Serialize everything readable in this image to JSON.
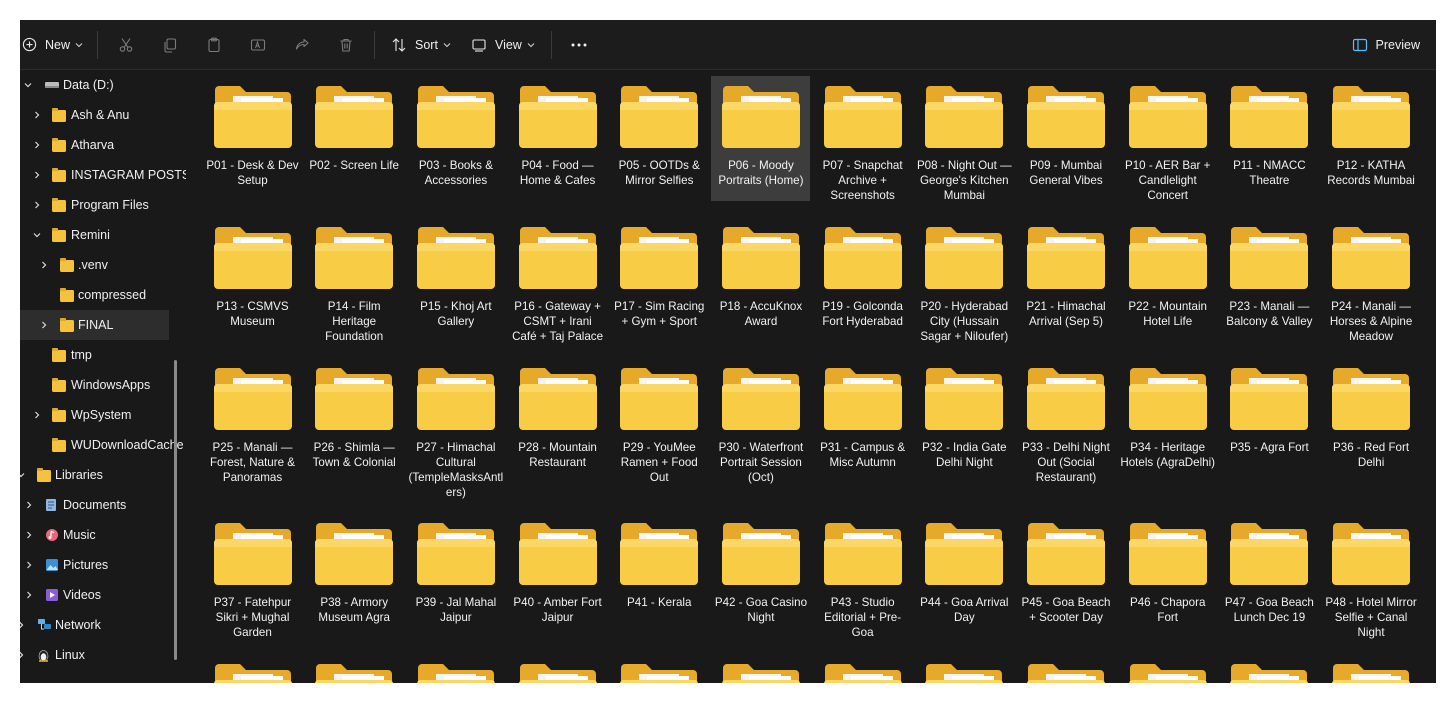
{
  "toolbar": {
    "new_label": "New",
    "sort_label": "Sort",
    "view_label": "View",
    "more_label": "•••",
    "preview_label": "Preview"
  },
  "sidebar": {
    "drive": "Data (D:)",
    "items": [
      {
        "label": "Ash &  Anu"
      },
      {
        "label": "Atharva"
      },
      {
        "label": "INSTAGRAM POSTS"
      },
      {
        "label": "Program Files"
      },
      {
        "label": "Remini"
      },
      {
        "label": ".venv"
      },
      {
        "label": "compressed"
      },
      {
        "label": "FINAL"
      },
      {
        "label": "tmp"
      },
      {
        "label": "WindowsApps"
      },
      {
        "label": "WpSystem"
      },
      {
        "label": "WUDownloadCache"
      }
    ],
    "libraries": "Libraries",
    "documents": "Documents",
    "music": "Music",
    "pictures": "Pictures",
    "videos": "Videos",
    "network": "Network",
    "linux": "Linux"
  },
  "folders": [
    "P01 - Desk & Dev Setup",
    "P02 - Screen Life",
    "P03 - Books & Accessories",
    "P04 - Food — Home & Cafes",
    "P05 - OOTDs & Mirror Selfies",
    "P06 - Moody Portraits (Home)",
    "P07 - Snapchat Archive + Screenshots",
    "P08 - Night Out — George's Kitchen Mumbai",
    "P09 - Mumbai General Vibes",
    "P10 - AER Bar + Candlelight Concert",
    "P11 - NMACC Theatre",
    "P12 - KATHA Records Mumbai",
    "P13 - CSMVS Museum",
    "P14 - Film Heritage Foundation",
    "P15 - Khoj Art Gallery",
    "P16 - Gateway + CSMT + Irani Café + Taj Palace",
    "P17 - Sim Racing + Gym + Sport",
    "P18 - AccuKnox Award",
    "P19 - Golconda Fort Hyderabad",
    "P20 - Hyderabad City (Hussain Sagar + Niloufer)",
    "P21 - Himachal Arrival (Sep 5)",
    "P22 - Mountain Hotel Life",
    "P23 - Manali — Balcony & Valley",
    "P24 - Manali — Horses & Alpine Meadow",
    "P25 - Manali — Forest, Nature & Panoramas",
    "P26 - Shimla — Town & Colonial",
    "P27 - Himachal Cultural (TempleMasksAntlers)",
    "P28 - Mountain Restaurant",
    "P29 - YouMee Ramen + Food Out",
    "P30 - Waterfront Portrait Session (Oct)",
    "P31 - Campus & Misc Autumn",
    "P32 - India Gate Delhi Night",
    "P33 - Delhi Night Out (Social Restaurant)",
    "P34 - Heritage Hotels (AgraDelhi)",
    "P35 - Agra Fort",
    "P36 - Red Fort Delhi",
    "P37 - Fatehpur Sikri + Mughal Garden",
    "P38 - Armory Museum Agra",
    "P39 - Jal Mahal Jaipur",
    "P40 - Amber Fort Jaipur",
    "P41 - Kerala",
    "P42 - Goa Casino Night",
    "P43 - Studio Editorial + Pre-Goa",
    "P44 - Goa Arrival Day",
    "P45 - Goa Beach + Scooter Day",
    "P46 - Chapora Fort",
    "P47 - Goa Beach Lunch Dec 19",
    "P48 - Hotel Mirror Selfie + Canal Night",
    "",
    "",
    "",
    "",
    "",
    "",
    "",
    "",
    "",
    "",
    "",
    ""
  ],
  "selected_folder": "P06 - Moody Portraits (Home)",
  "colors": {
    "background": "#191919",
    "folder_front": "#f8cd45",
    "folder_back": "#e6a92a",
    "selection": "#3d3d3d",
    "preview_icon": "#4cc2ff"
  }
}
